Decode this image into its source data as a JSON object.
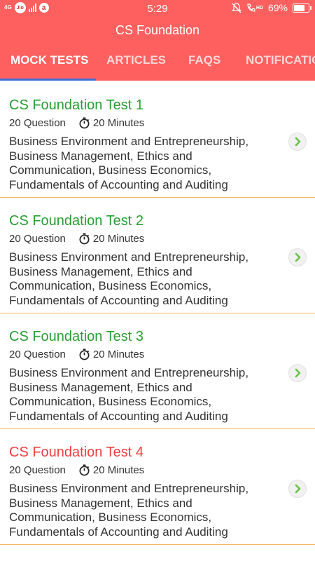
{
  "status_bar": {
    "network": "4G",
    "carrier": "Jio",
    "time": "5:29",
    "vo_lte": "HD",
    "battery": "69%",
    "icons": [
      "signal-icon",
      "airtel-icon",
      "mute-icon",
      "call-icon",
      "battery-icon"
    ]
  },
  "app_bar": {
    "title": "CS Foundation"
  },
  "tabs": [
    {
      "label": "MOCK TESTS",
      "active": true
    },
    {
      "label": "ARTICLES",
      "active": false
    },
    {
      "label": "FAQS",
      "active": false
    },
    {
      "label": "NOTIFICATIO",
      "active": false
    }
  ],
  "tests": [
    {
      "title": "CS Foundation Test 1",
      "questions": "20 Question",
      "duration": "20 Minutes",
      "description": "Business Environment and Entrepreneurship, Business Management, Ethics and Communication, Business Economics, Fundamentals of Accounting and Auditing",
      "title_color": "#2a9d33"
    },
    {
      "title": "CS Foundation Test 2",
      "questions": "20 Question",
      "duration": "20 Minutes",
      "description": "Business Environment and Entrepreneurship, Business Management, Ethics and Communication, Business Economics, Fundamentals of Accounting and Auditing",
      "title_color": "#2a9d33"
    },
    {
      "title": "CS Foundation Test 3",
      "questions": "20 Question",
      "duration": "20 Minutes",
      "description": "Business Environment and Entrepreneurship, Business Management, Ethics and Communication, Business Economics, Fundamentals of Accounting and Auditing",
      "title_color": "#2a9d33"
    },
    {
      "title": "CS Foundation Test 4",
      "questions": "20 Question",
      "duration": "20 Minutes",
      "description": "Business Environment and Entrepreneurship, Business Management, Ethics and Communication, Business Economics, Fundamentals of Accounting and Auditing",
      "title_color": "#ef3e3e"
    }
  ],
  "colors": {
    "primary": "#fe5f5f",
    "tab_indicator": "#3f6fd8",
    "divider": "#f3b860",
    "arrow": "#6cc04a"
  }
}
